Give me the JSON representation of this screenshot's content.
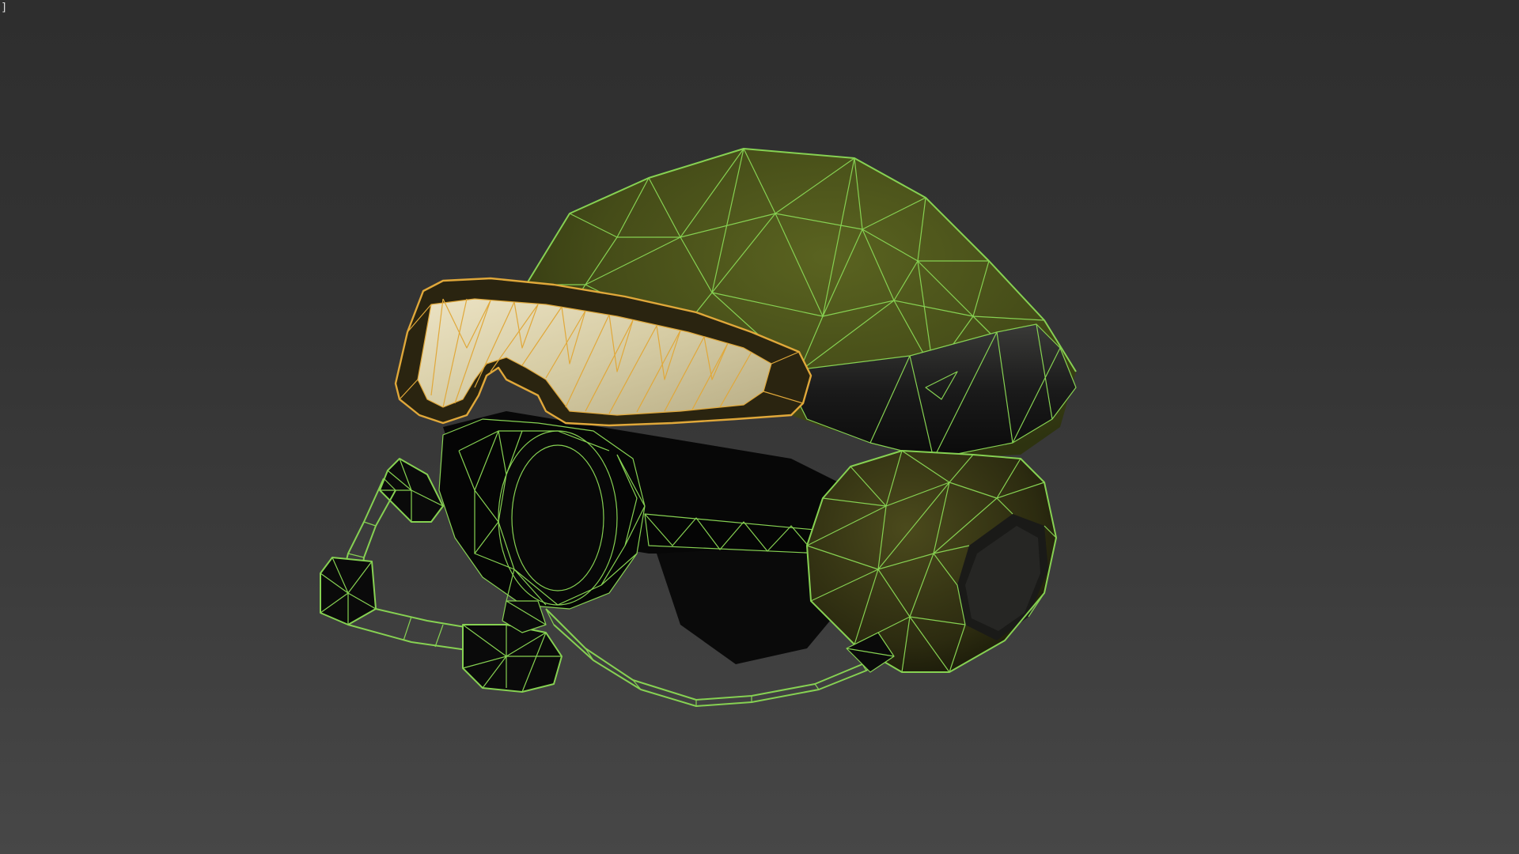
{
  "viewport": {
    "label": "]",
    "background_top": "#2e2e2e",
    "background_bottom": "#474747"
  },
  "model": {
    "wire_color_selected": "#86d152",
    "wire_color_goggles": "#e0a83a",
    "shell_color": "#4a5219",
    "lens_color": "#d9cfa8"
  }
}
